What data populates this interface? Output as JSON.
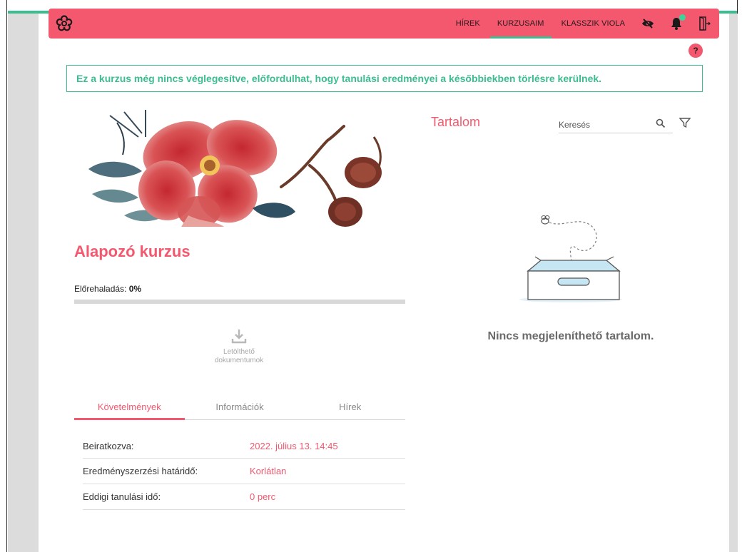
{
  "header": {
    "logo_icon": "flower-logo-icon",
    "nav": [
      {
        "label": "HÍREK",
        "active": false
      },
      {
        "label": "KURZUSAIM",
        "active": true
      },
      {
        "label": "KLASSZIK VIOLA",
        "active": false
      }
    ],
    "icons": [
      "eye-slash-icon",
      "bell-icon",
      "logout-door-icon"
    ],
    "accent_color": "#f4586e",
    "notification_dot_color": "#3cd49a"
  },
  "help": {
    "label": "?"
  },
  "notice": {
    "text": "Ez a kurzus még nincs véglegesítve, előfordulhat, hogy tanulási eredményei a későbbiekben törlésre kerülnek."
  },
  "course": {
    "title": "Alapozó kurzus",
    "progress_label": "Előrehaladás:",
    "progress_value": "0%",
    "progress_fraction": 0,
    "docs_label_line1": "Letölthető",
    "docs_label_line2": "dokumentumok"
  },
  "tabs": [
    {
      "label": "Követelmények",
      "active": true
    },
    {
      "label": "Információk",
      "active": false
    },
    {
      "label": "Hírek",
      "active": false
    }
  ],
  "info_rows": [
    {
      "key": "Beiratkozva:",
      "value": "2022. július 13. 14:45"
    },
    {
      "key": "Eredményszerzési határidő:",
      "value": "Korlátlan"
    },
    {
      "key": "Eddigi tanulási idő:",
      "value": "0 perc"
    }
  ],
  "content": {
    "title": "Tartalom",
    "search_placeholder": "Keresés",
    "empty_text": "Nincs megjeleníthető tartalom."
  }
}
